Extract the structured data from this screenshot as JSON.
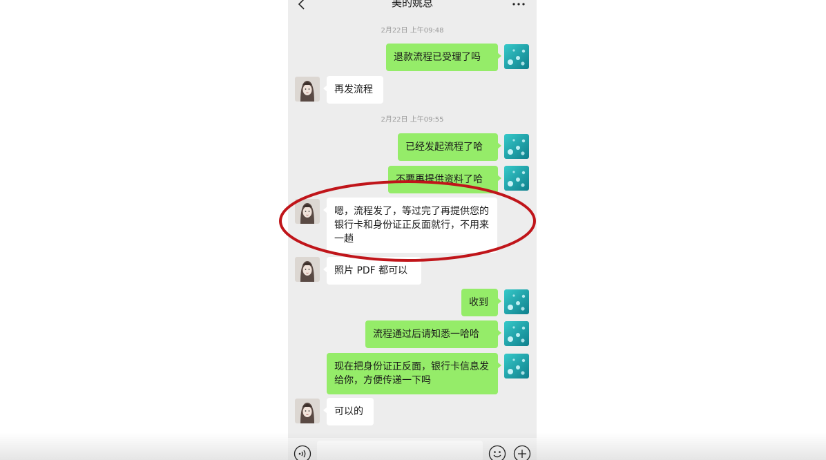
{
  "header": {
    "title": "美的姚总"
  },
  "messages": [
    {
      "type": "timestamp",
      "text": "2月22日 上午09:48"
    },
    {
      "type": "out",
      "text": "退款流程已受理了吗"
    },
    {
      "type": "in",
      "text": "再发流程"
    },
    {
      "type": "timestamp",
      "text": "2月22日 上午09:55"
    },
    {
      "type": "out",
      "text": "已经发起流程了哈"
    },
    {
      "type": "out",
      "text": "不要再提供资料了哈"
    },
    {
      "type": "in",
      "text": "嗯，流程发了，等过完了再提供您的银行卡和身份证正反面就行，不用来一趟"
    },
    {
      "type": "in",
      "text": "照片 PDF 都可以"
    },
    {
      "type": "out",
      "text": "收到"
    },
    {
      "type": "out",
      "text": "流程通过后请知悉一哈哈"
    },
    {
      "type": "out",
      "text": "现在把身份证正反面，银行卡信息发给你，方便传递一下吗"
    },
    {
      "type": "in",
      "text": "可以的"
    }
  ],
  "icons": {
    "back": "chevron-left-icon",
    "more": "more-dots-icon",
    "voice": "voice-icon",
    "emoji": "emoji-icon",
    "plus": "plus-icon"
  },
  "colors": {
    "chat_background": "#ededed",
    "outgoing_bubble": "#95ec69",
    "incoming_bubble": "#ffffff",
    "annotation_circle": "#c0151a"
  }
}
